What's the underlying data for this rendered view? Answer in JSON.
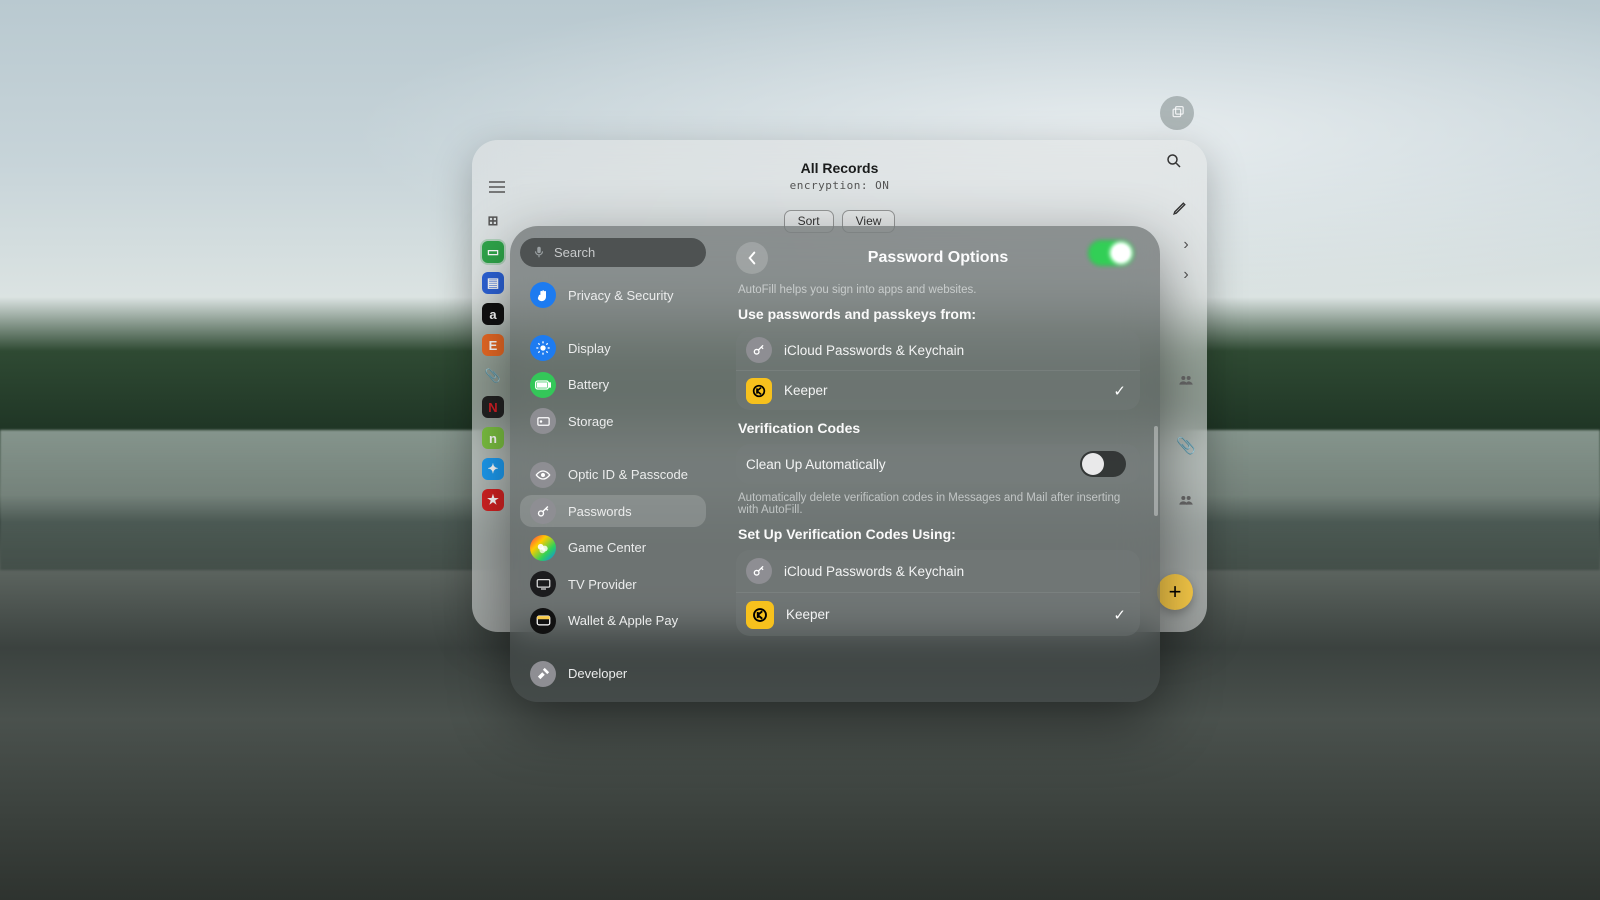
{
  "records": {
    "title": "All Records",
    "subtitle": "encryption: ON",
    "sort": "Sort",
    "view": "View",
    "add": "+"
  },
  "sidebar": {
    "search_placeholder": "Search",
    "privacy": "Privacy & Security",
    "display": "Display",
    "battery": "Battery",
    "storage": "Storage",
    "optic": "Optic ID & Passcode",
    "passwords": "Passwords",
    "game": "Game Center",
    "tv": "TV Provider",
    "wallet": "Wallet & Apple Pay",
    "developer": "Developer"
  },
  "detail": {
    "title": "Password Options",
    "autoFillHint": "AutoFill helps you sign into apps and websites.",
    "useFromLabel": "Use passwords and passkeys from:",
    "providers": {
      "icloud": "iCloud Passwords & Keychain",
      "keeper": "Keeper"
    },
    "verifLabel": "Verification Codes",
    "cleanup": "Clean Up Automatically",
    "cleanupHint": "Automatically delete verification codes in Messages and Mail after inserting with AutoFill.",
    "setupLabel": "Set Up Verification Codes Using:",
    "setupProviders": {
      "icloud": "iCloud Passwords & Keychain",
      "keeper": "Keeper"
    }
  }
}
